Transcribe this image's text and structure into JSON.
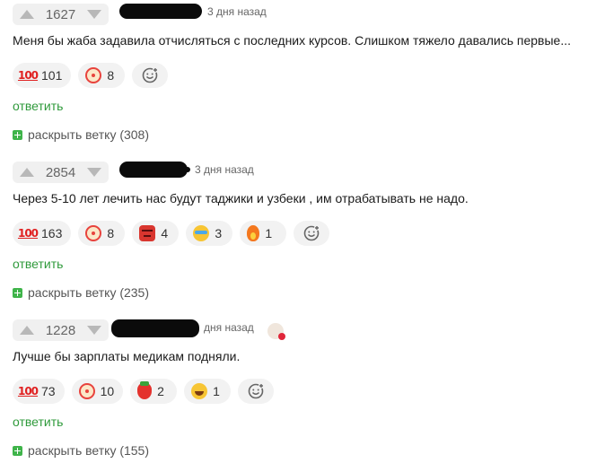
{
  "comments": [
    {
      "votes": "1627",
      "time": "3 дня назад",
      "text": "Меня бы жаба задавила отчисляться с последних курсов. Слишком тяжело давались первые...",
      "reactions": [
        {
          "icon": "hundred-points-icon",
          "count": "101"
        },
        {
          "icon": "clown-face-icon",
          "count": "8"
        }
      ],
      "reply_label": "ответить",
      "expand_label": "раскрыть ветку (308)"
    },
    {
      "votes": "2854",
      "time": "3 дня назад",
      "text": "Через 5-10 лет лечить нас будут таджики и узбеки , им отрабатывать не надо.",
      "reactions": [
        {
          "icon": "hundred-points-icon",
          "count": "163"
        },
        {
          "icon": "clown-face-icon",
          "count": "8"
        },
        {
          "icon": "angry-face-icon",
          "count": "4"
        },
        {
          "icon": "crying-face-icon",
          "count": "3"
        },
        {
          "icon": "fire-icon",
          "count": "1"
        }
      ],
      "reply_label": "ответить",
      "expand_label": "раскрыть ветку (235)"
    },
    {
      "votes": "1228",
      "time": "дня назад",
      "text": "Лучше бы зарплаты медикам подняли.",
      "reactions": [
        {
          "icon": "hundred-points-icon",
          "count": "73"
        },
        {
          "icon": "clown-face-icon",
          "count": "10"
        },
        {
          "icon": "strawberry-icon",
          "count": "2"
        },
        {
          "icon": "laughing-face-icon",
          "count": "1"
        }
      ],
      "reply_label": "ответить",
      "expand_label": "раскрыть ветку (155)"
    }
  ],
  "ui": {
    "hundred_glyph": "100",
    "accent_green": "#2f9a3b",
    "expand_green": "#3fb44a"
  }
}
